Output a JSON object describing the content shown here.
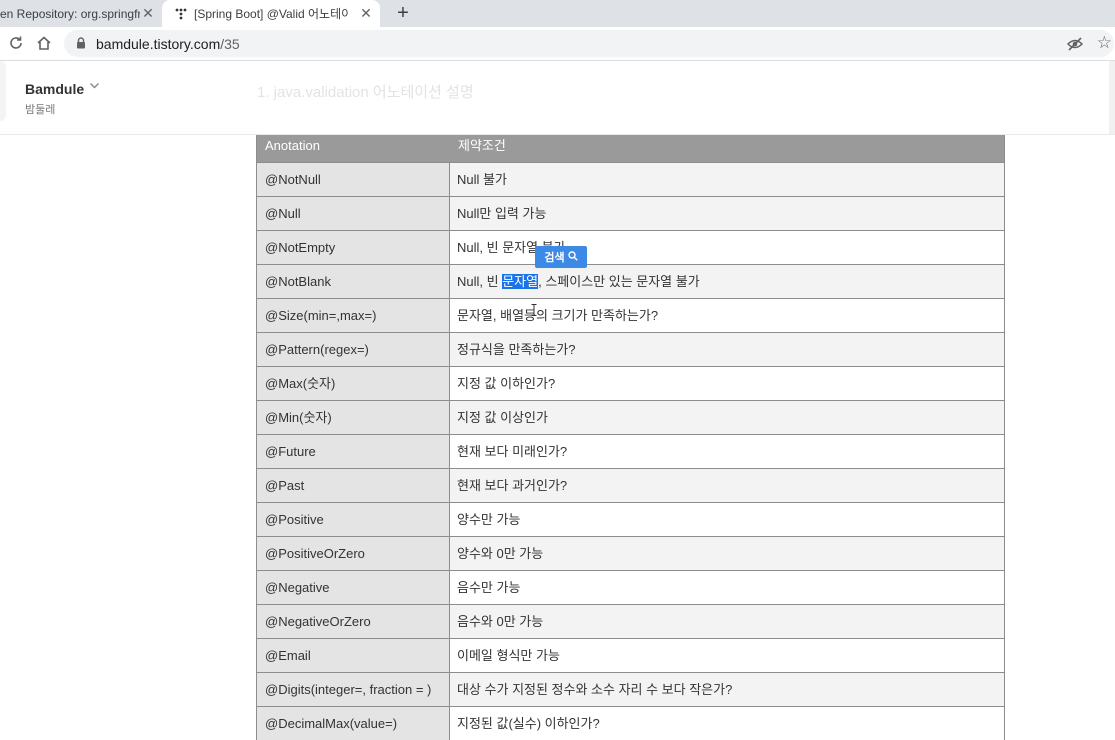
{
  "browser": {
    "tabs": [
      {
        "title": "en Repository: org.springframework",
        "close": "✕"
      },
      {
        "title": "[Spring Boot] @Valid 어노테이션",
        "close": "✕"
      }
    ],
    "new_tab": "+",
    "url_host": "bamdule.tistory.com",
    "url_path": "/35",
    "icons": [
      "reload-icon",
      "home-icon",
      "lock-icon",
      "eye-off-icon",
      "star-icon"
    ]
  },
  "blog": {
    "name": "Bamdule",
    "subtitle": "밤둘레",
    "section_heading": "1. java.validation 어노테이션 설명"
  },
  "table": {
    "headers": [
      "Anotation",
      "제약조건"
    ],
    "rows": [
      {
        "annotation": "@NotNull",
        "constraint": "Null 불가"
      },
      {
        "annotation": "@Null",
        "constraint": "Null만 입력 가능"
      },
      {
        "annotation": "@NotEmpty",
        "constraint": "Null, 빈 문자열 불가"
      },
      {
        "annotation": "@NotBlank",
        "constraint_before": "Null, 빈 ",
        "constraint_highlight": "문자열",
        "constraint_after": ", 스페이스만 있는 문자열 불가"
      },
      {
        "annotation": "@Size(min=,max=)",
        "constraint": "문자열, 배열등의 크기가 만족하는가?"
      },
      {
        "annotation": "@Pattern(regex=)",
        "constraint": "정규식을 만족하는가?"
      },
      {
        "annotation": "@Max(숫자)",
        "constraint": "지정 값 이하인가?"
      },
      {
        "annotation": "@Min(숫자)",
        "constraint": "지정 값 이상인가"
      },
      {
        "annotation": "@Future",
        "constraint": "현재 보다 미래인가?"
      },
      {
        "annotation": "@Past",
        "constraint": "현재 보다 과거인가?"
      },
      {
        "annotation": "@Positive",
        "constraint": "양수만 가능"
      },
      {
        "annotation": "@PositiveOrZero",
        "constraint": "양수와 0만 가능"
      },
      {
        "annotation": "@Negative",
        "constraint": "음수만 가능"
      },
      {
        "annotation": "@NegativeOrZero",
        "constraint": "음수와 0만 가능"
      },
      {
        "annotation": "@Email",
        "constraint": "이메일 형식만 가능"
      },
      {
        "annotation": "@Digits(integer=, fraction = )",
        "constraint": "대상 수가 지정된 정수와 소수 자리 수 보다 작은가?"
      },
      {
        "annotation": "@DecimalMax(value=)",
        "constraint": "지정된 값(실수) 이하인가?"
      }
    ]
  },
  "search_popup": {
    "label": "검색",
    "icon": "search-icon"
  },
  "colors": {
    "header_bg": "#9a9a9a",
    "highlight": "#1a73e8",
    "popup": "#3d8ae6"
  }
}
